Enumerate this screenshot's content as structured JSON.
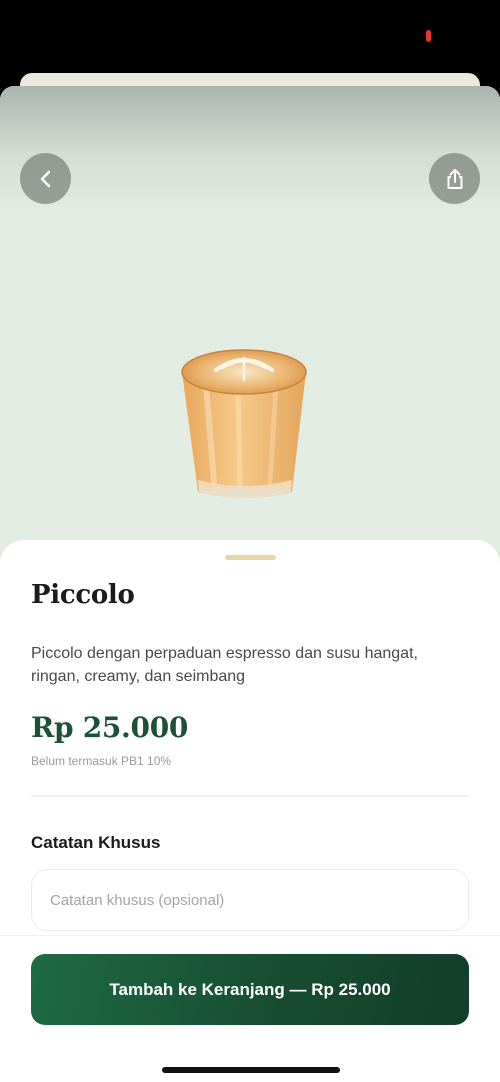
{
  "header": {
    "back_icon": "chevron-left-icon",
    "share_icon": "share-icon"
  },
  "product": {
    "title": "Piccolo",
    "description": "Piccolo dengan perpaduan espresso dan susu hangat, ringan, creamy, dan seimbang",
    "price": "Rp 25.000",
    "tax_note": "Belum termasuk PB1 10%"
  },
  "notes": {
    "label": "Catatan Khusus",
    "placeholder": "Catatan khusus (opsional)",
    "value": ""
  },
  "footer": {
    "add_to_cart_label": "Tambah ke Keranjang — Rp 25.000"
  },
  "colors": {
    "brand_green": "#1d5137",
    "handle": "#e6d8a4",
    "hero_background": "#e4ede3"
  }
}
